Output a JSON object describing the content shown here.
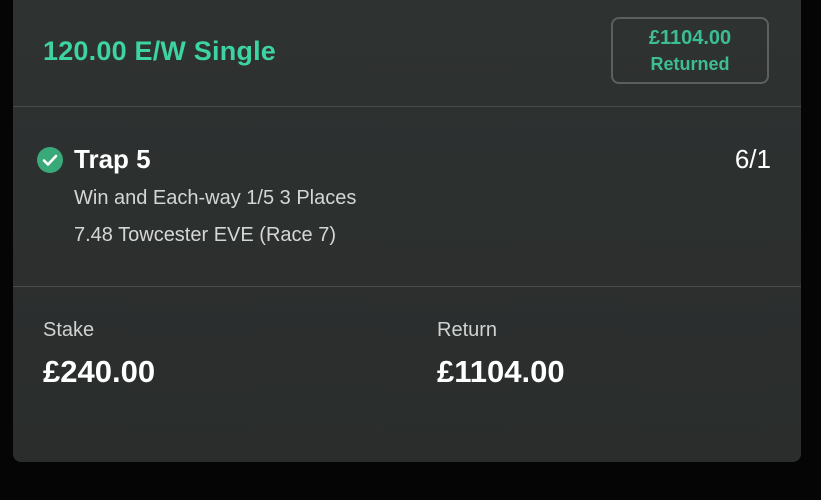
{
  "bet": {
    "title": "120.00 E/W Single",
    "badge": {
      "amount": "£1104.00",
      "label": "Returned"
    }
  },
  "selection": {
    "status_icon": "check-circle-icon",
    "name": "Trap 5",
    "odds": "6/1",
    "market": "Win and Each-way 1/5 3 Places",
    "event": "7.48 Towcester EVE (Race 7)"
  },
  "summary": {
    "stake_label": "Stake",
    "stake_value": "£240.00",
    "return_label": "Return",
    "return_value": "£1104.00"
  },
  "colors": {
    "accent_green": "#3dd3a2",
    "check_green": "#3aa97a",
    "card_bg": "#2c302f"
  }
}
